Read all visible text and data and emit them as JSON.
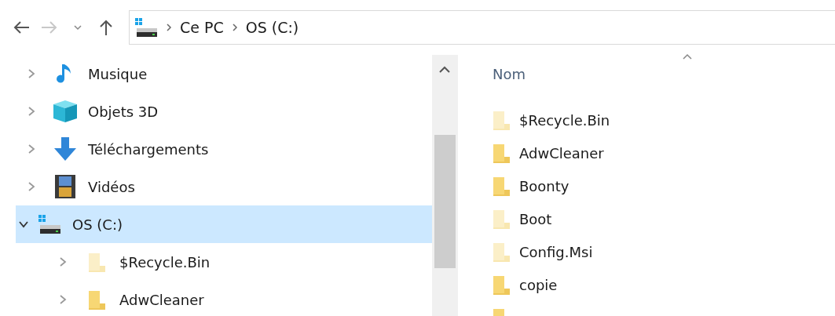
{
  "address_bar": {
    "path": [
      "Ce PC",
      "OS (C:)"
    ]
  },
  "nav_pane": {
    "items": [
      {
        "label": "Musique",
        "kind": "music",
        "expanded": false,
        "selected": false
      },
      {
        "label": "Objets 3D",
        "kind": "objects3d",
        "expanded": false,
        "selected": false
      },
      {
        "label": "Téléchargements",
        "kind": "download",
        "expanded": false,
        "selected": false
      },
      {
        "label": "Vidéos",
        "kind": "videos",
        "expanded": false,
        "selected": false
      },
      {
        "label": "OS (C:)",
        "kind": "drive",
        "expanded": true,
        "selected": true,
        "children": [
          {
            "label": "$Recycle.Bin",
            "kind": "folder",
            "hidden": true,
            "expanded": false,
            "selected": false
          },
          {
            "label": "AdwCleaner",
            "kind": "folder",
            "hidden": false,
            "expanded": false,
            "selected": false
          }
        ]
      }
    ]
  },
  "file_list": {
    "columns": [
      {
        "label": "Nom",
        "sorted": true
      }
    ],
    "rows": [
      {
        "name": "$Recycle.Bin",
        "hidden": true
      },
      {
        "name": "AdwCleaner",
        "hidden": false
      },
      {
        "name": "Boonty",
        "hidden": false
      },
      {
        "name": "Boot",
        "hidden": true
      },
      {
        "name": "Config.Msi",
        "hidden": true
      },
      {
        "name": "copie",
        "hidden": false
      },
      {
        "hidden": false
      }
    ]
  }
}
